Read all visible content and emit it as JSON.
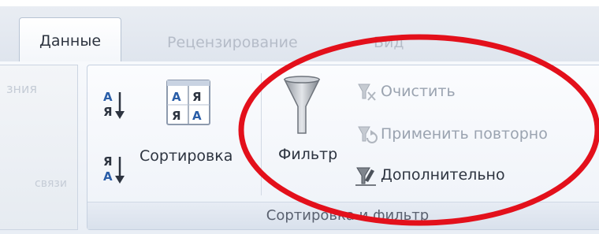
{
  "tabs": {
    "active": "Данные",
    "review": "Рецензирование",
    "view": "Вид"
  },
  "prev_group": {
    "top_fragment": "зния",
    "bottom_fragment": "связи"
  },
  "sort_filter": {
    "group_label": "Сортировка и фильтр",
    "sort_label": "Сортировка",
    "filter_label": "Фильтр",
    "clear_label": "Очистить",
    "reapply_label": "Применить повторно",
    "advanced_label": "Дополнительно",
    "sort_az_glyph": "А\nЯ",
    "sort_za_glyph": "Я\nА",
    "sort_dialog_glyph": "А Я\nЯ А"
  },
  "icons": [
    "sort-az-icon",
    "sort-za-icon",
    "sort-dialog-icon",
    "filter-funnel-icon",
    "clear-filter-icon",
    "reapply-filter-icon",
    "advanced-filter-icon"
  ],
  "colors": {
    "annotation_ellipse": "#e3101b"
  }
}
